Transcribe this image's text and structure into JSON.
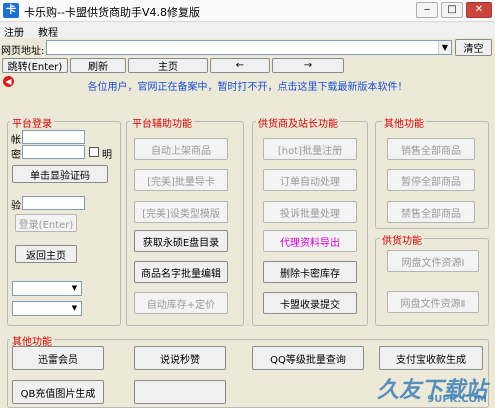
{
  "window": {
    "icon_glyph": "卡",
    "title": "卡乐购--卡盟供货商助手V4.8修复版",
    "minimize": "‒",
    "restore": "□",
    "close": "✕"
  },
  "menu": [
    "注册",
    "教程"
  ],
  "url_bar": {
    "label": "网页地址:",
    "value": "",
    "clear_label": "清空"
  },
  "nav": {
    "jump": "跳转(Enter)",
    "refresh": "刷新",
    "home": "主页",
    "back": "←",
    "forward": "→"
  },
  "notice": "各位用户，官网正在备案中，暂时打不开，点击这里下载最新版本软件！",
  "platform_login": {
    "title": "平台登录",
    "account_label": "帐",
    "password_label": "密",
    "show_label": "明",
    "show_captcha": "单击显验证码",
    "captcha_label": "验",
    "login": "登录(Enter)",
    "return_home": "返回主页"
  },
  "platform_aux": {
    "title": "平台辅助功能",
    "buttons": [
      "自动上架商品",
      "[完美]批量导卡",
      "[完美]设类型模版",
      "获取永硕E盘目录",
      "商品名字批量编辑",
      "自动库存+定价"
    ]
  },
  "supplier_growth": {
    "title": "供货商及站长功能",
    "buttons": [
      "[hot]批量注册",
      "订单自动处理",
      "投诉批量处理",
      "代理资料导出",
      "删除卡密库存",
      "卡盟收录提交"
    ]
  },
  "other_top": {
    "title": "其他功能",
    "buttons": [
      "销售全部商品",
      "暂停全部商品",
      "禁售全部商品"
    ]
  },
  "supply": {
    "title": "供货功能",
    "buttons": [
      "网盘文件资源Ⅰ",
      "网盘文件资源Ⅱ"
    ]
  },
  "other_bottom": {
    "title": "其他功能",
    "buttons": [
      "迅雷会员",
      "说说秒赞",
      "QQ等级批量查询",
      "支付宝收款生成",
      "QB充值图片生成"
    ]
  },
  "watermark": {
    "main": "久友下载站",
    "url": "9UPK.COM"
  }
}
